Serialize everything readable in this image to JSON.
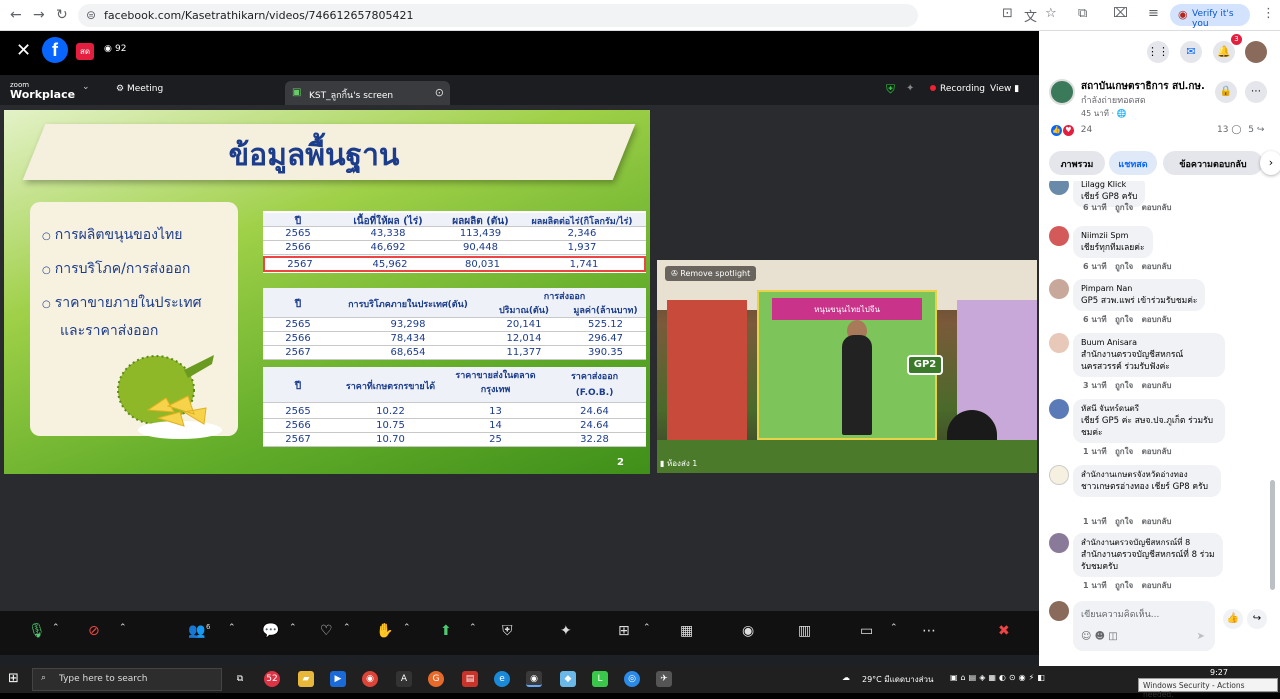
{
  "browser": {
    "url": "facebook.com/Kasetrathikarn/videos/746612657805421",
    "verify": "Verify it's you"
  },
  "fb": {
    "live": "สด",
    "viewers": "92"
  },
  "zoom": {
    "logo1": "zoom",
    "logo2": "Workplace",
    "meeting": "Meeting",
    "screen_tab": "KST_ลูกกิ้น's screen",
    "recording": "Recording",
    "view": "View"
  },
  "slide": {
    "title": "ข้อมูลพื้นฐาน",
    "bullets": [
      "การผลิตขนุนของไทย",
      "การบริโภค/การส่งออก",
      "ราคาขายภายในประเทศ",
      "และราคาส่งออก"
    ],
    "page": "2",
    "t1": {
      "headers": [
        "ปี",
        "เนื้อที่ให้ผล (ไร่)",
        "ผลผลิต (ตัน)",
        "ผลผลิตต่อไร่(กิโลกรัม/ไร่)"
      ],
      "rows": [
        [
          "2565",
          "43,338",
          "113,439",
          "2,346"
        ],
        [
          "2566",
          "46,692",
          "90,448",
          "1,937"
        ],
        [
          "2567",
          "45,962",
          "80,031",
          "1,741"
        ]
      ]
    },
    "t2": {
      "headers": [
        "ปี",
        "การบริโภคภายในประเทศ(ตัน)",
        "การส่งออก",
        "ปริมาณ(ตัน)",
        "มูลค่า(ล้านบาท)"
      ],
      "rows": [
        [
          "2565",
          "93,298",
          "20,141",
          "525.12"
        ],
        [
          "2566",
          "78,434",
          "12,014",
          "296.47"
        ],
        [
          "2567",
          "68,654",
          "11,377",
          "390.35"
        ]
      ]
    },
    "t3": {
      "headers": [
        "ปี",
        "ราคาที่เกษตรกรขายได้",
        "ราคาขายส่งในตลาดกรุงเทพ",
        "ราคาส่งออก",
        "(F.O.B.)"
      ],
      "rows": [
        [
          "2565",
          "10.22",
          "13",
          "24.64"
        ],
        [
          "2566",
          "10.75",
          "14",
          "24.64"
        ],
        [
          "2567",
          "10.70",
          "25",
          "32.28"
        ]
      ]
    }
  },
  "camera": {
    "spotlight": "Remove spotlight",
    "label": "ห้องส่ง 1",
    "banner": "หนุนขนุนไทยไปจีน",
    "gp2": "GP2"
  },
  "controls": {
    "participants": "6"
  },
  "side": {
    "page_name": "สถาบันเกษตราธิการ สป.กษ.",
    "live_status": "กำลังถ่ายทอดสด",
    "time": "45 นาที · ",
    "reactions": "24",
    "comments_count": "13",
    "shares": "5",
    "tabs": [
      "ภาพรวม",
      "แชทสด",
      "ข้อความตอบกลับ"
    ],
    "like": "ถูกใจ",
    "reply": "ตอบกลับ",
    "comments": [
      {
        "name": "Lilagg Klick",
        "text": "เชียร์ GP8 ครับ",
        "time": "6 นาที"
      },
      {
        "name": "Niimzii Spm",
        "text": "เชียร์ทุกทีมเลยค่ะ",
        "time": "6 นาที"
      },
      {
        "name": "Pimparn Nan",
        "text": "GP5 สวพ.แพร่ เข้าร่วมรับชมค่ะ",
        "time": "6 นาที"
      },
      {
        "name": "Buum Anisara",
        "text": "สำนักงานตรวจบัญชีสหกรณ์ นครสวรรค์ ร่วมรับฟังค่ะ",
        "time": "3 นาที"
      },
      {
        "name": "หัสนี จันทร์ดนตรี",
        "text": "เชียร์ GP5 ค่ะ สษจ.ปจ.ภูเก็ต ร่วมรับชมค่ะ",
        "time": "1 นาที"
      },
      {
        "name": "สำนักงานเกษตรจังหวัดอ่างทอง",
        "text": "ชาวเกษตรอ่างทอง เชียร์ GP8 ครับ",
        "time": "1 นาที"
      },
      {
        "name": "สำนักงานตรวจบัญชีสหกรณ์ที่ 8",
        "text": "สำนักงานตรวจบัญชีสหกรณ์ที่ 8 ร่วมรับชมครับ",
        "time": "1 นาที"
      }
    ],
    "composer": "เขียนความคิดเห็น..."
  },
  "taskbar": {
    "search": "Type here to search",
    "temp": "29°C มีแดดบางส่วน",
    "time": "9:27",
    "winsec": "Windows Security - Actions needed."
  }
}
